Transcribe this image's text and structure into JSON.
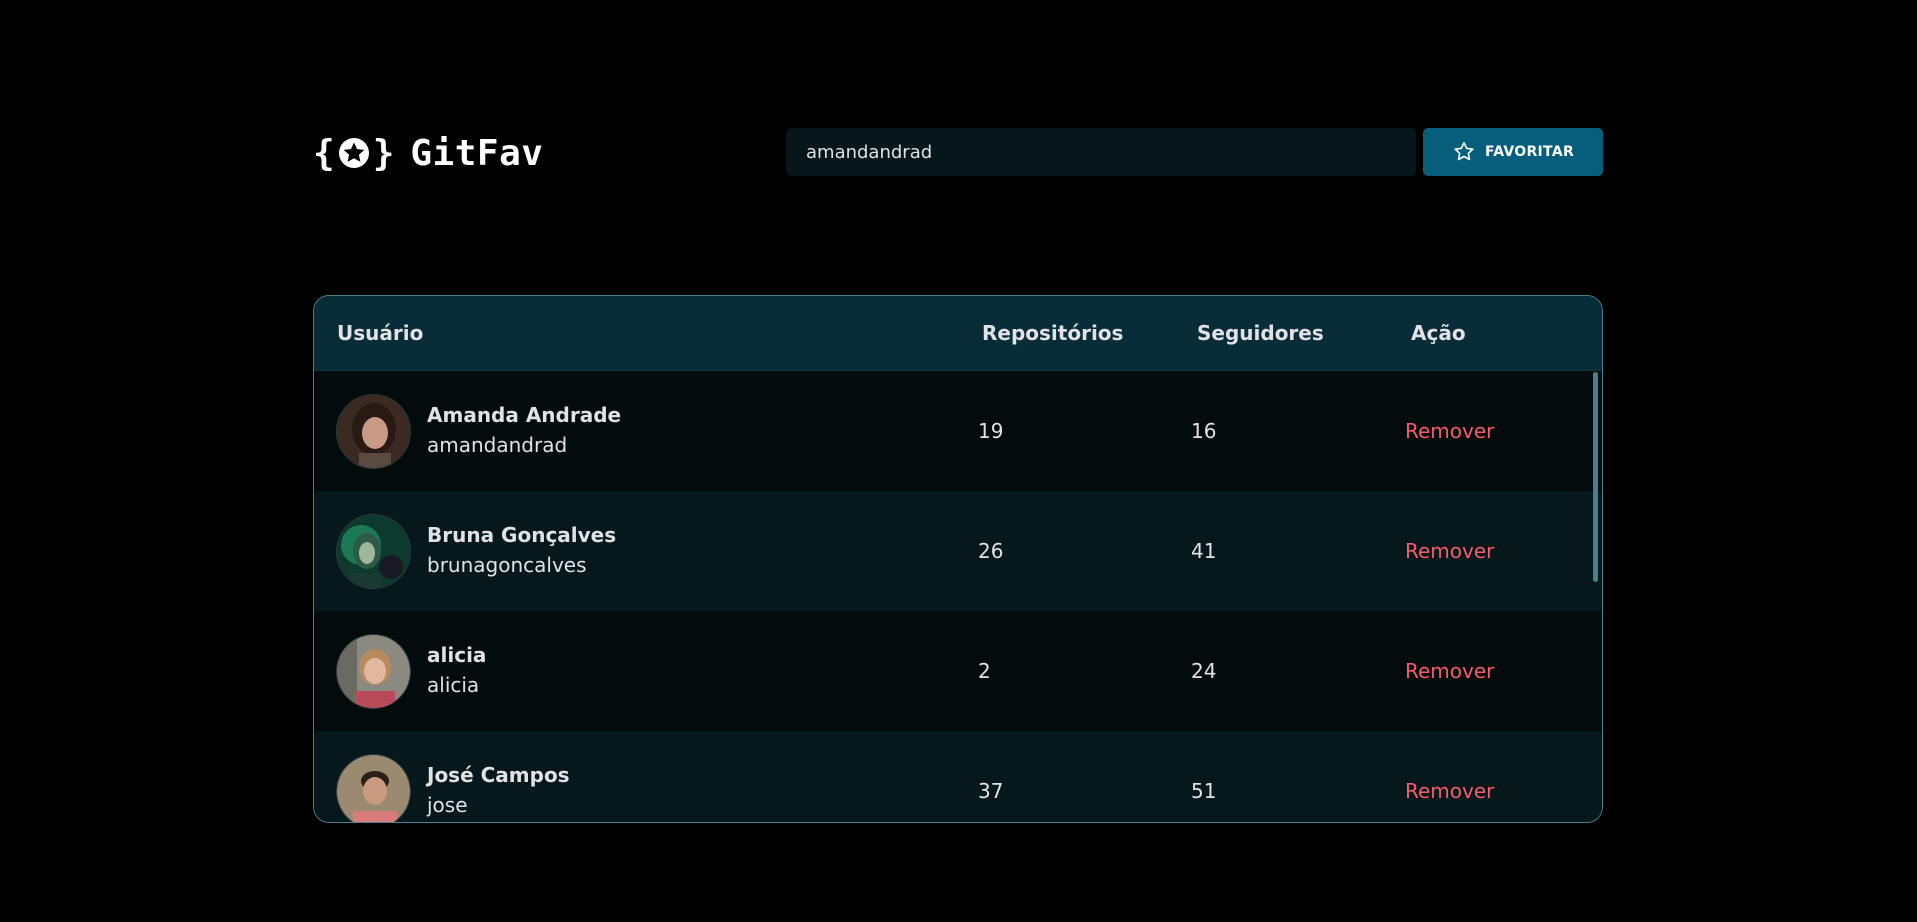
{
  "app": {
    "brand": "GitFav"
  },
  "search": {
    "value": "amandandrad"
  },
  "favorite_button": {
    "label": "FAVORITAR"
  },
  "colors": {
    "background": "#000000",
    "accent": "#065E7C",
    "table_header": "#092D38",
    "remove": "#F75A68",
    "border": "#4A808C"
  },
  "table": {
    "headers": {
      "user": "Usuário",
      "repos": "Repositórios",
      "followers": "Seguidores",
      "action": "Ação"
    },
    "rows": [
      {
        "name": "Amanda Andrade",
        "login": "amandandrad",
        "repos": "19",
        "followers": "16",
        "action": "Remover",
        "avatar": "avatar-amanda"
      },
      {
        "name": "Bruna Gonçalves",
        "login": "brunagoncalves",
        "repos": "26",
        "followers": "41",
        "action": "Remover",
        "avatar": "avatar-bruna"
      },
      {
        "name": "alicia",
        "login": "alicia",
        "repos": "2",
        "followers": "24",
        "action": "Remover",
        "avatar": "avatar-alicia"
      },
      {
        "name": "José Campos",
        "login": "jose",
        "repos": "37",
        "followers": "51",
        "action": "Remover",
        "avatar": "avatar-jose"
      }
    ]
  }
}
